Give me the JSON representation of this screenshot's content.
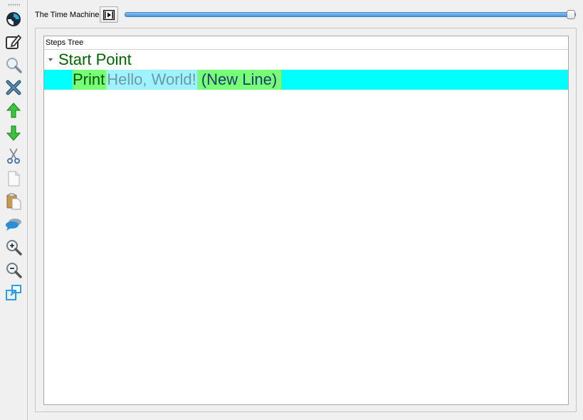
{
  "toolbar": {
    "items": [
      {
        "name": "logo-icon",
        "tooltip": ""
      },
      {
        "name": "edit-icon"
      },
      {
        "name": "search-icon"
      },
      {
        "name": "delete-icon"
      },
      {
        "name": "move-up-icon"
      },
      {
        "name": "move-down-icon"
      },
      {
        "name": "cut-icon"
      },
      {
        "name": "copy-icon"
      },
      {
        "name": "paste-icon"
      },
      {
        "name": "comment-icon"
      },
      {
        "name": "zoom-in-icon"
      },
      {
        "name": "zoom-out-icon"
      },
      {
        "name": "popout-icon"
      }
    ]
  },
  "time_machine": {
    "label": "The Time Machine",
    "slider_value": 1.0
  },
  "steps_tree": {
    "header": "Steps Tree",
    "root": {
      "label": "Start Point",
      "expanded": true,
      "children": [
        {
          "keyword": "Print",
          "argument": "Hello, World!",
          "suffix": "(New Line)",
          "selected": true
        }
      ]
    }
  },
  "colors": {
    "selection": "#00ffff",
    "keyword_bg": "#77ff77",
    "argument_bg": "#9ff3ff",
    "root_text": "#006400",
    "slider": "#4a94d8"
  }
}
